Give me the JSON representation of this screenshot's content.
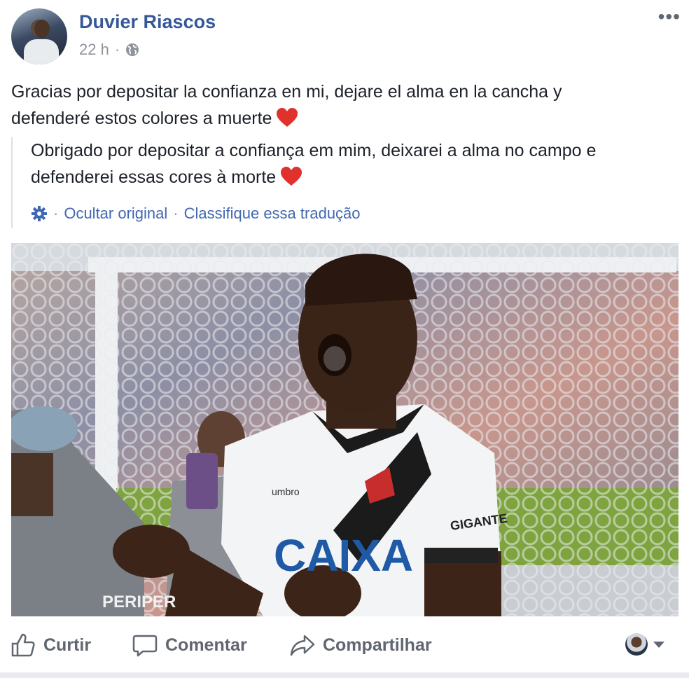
{
  "post": {
    "author": "Duvier Riascos",
    "time": "22 h",
    "separator": "·",
    "text": "Gracias por depositar la confianza en mi, dejare el alma en la cancha y defenderé estos colores a muerte",
    "translation": {
      "text": "Obrigado por depositar a confiança em mim, deixarei a alma no campo e defenderei essas cores à morte",
      "hide_original": "Ocultar original",
      "rate_translation": "Classifique essa tradução",
      "dot": "·"
    },
    "photo": {
      "jersey_text": "CAIXA",
      "brand_text": "umbro",
      "patch_text": "GIGANTE",
      "sleeve_text": "PERIPER"
    },
    "actions": {
      "like": "Curtir",
      "comment": "Comentar",
      "share": "Compartilhar"
    }
  },
  "colors": {
    "author_link": "#365899",
    "link": "#4267b2",
    "meta": "#90949c",
    "heart": "#e0312c"
  }
}
